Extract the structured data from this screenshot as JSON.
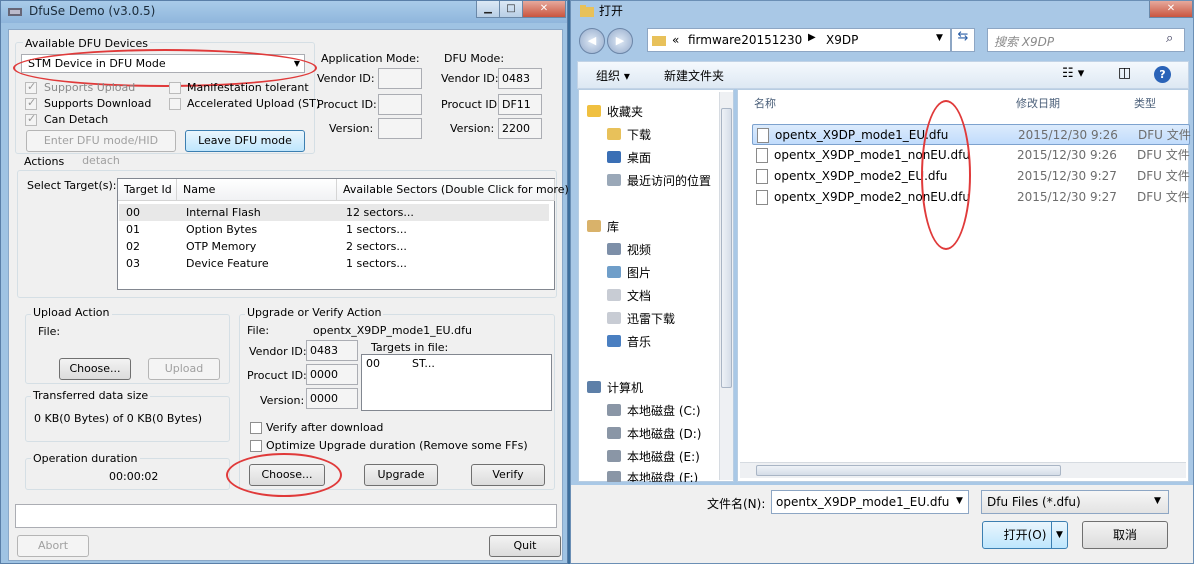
{
  "left": {
    "title": "DfuSe Demo (v3.0.5)",
    "available_label": "Available DFU Devices",
    "device_select": "STM Device in DFU Mode",
    "supports_upload": "Supports Upload",
    "supports_download": "Supports Download",
    "can_detach": "Can Detach",
    "manifestation": "Manifestation tolerant",
    "accel_upload": "Accelerated Upload (ST)",
    "enter_dfu_btn": "Enter DFU mode/HID detach",
    "leave_dfu_btn": "Leave DFU mode",
    "app_mode_label": "Application Mode:",
    "dfu_mode_label": "DFU Mode:",
    "vendor_id_label": "Vendor ID:",
    "procuct_id_label": "Procuct ID:",
    "version_label": "Version:",
    "dfu_vendor": "0483",
    "dfu_product": "DF11",
    "dfu_version": "2200",
    "actions_label": "Actions",
    "select_target_label": "Select Target(s):",
    "table_headers": [
      "Target Id",
      "Name",
      "Available Sectors (Double Click for more)"
    ],
    "table_rows": [
      {
        "id": "00",
        "name": "Internal Flash",
        "sectors": "12 sectors..."
      },
      {
        "id": "01",
        "name": "Option Bytes",
        "sectors": "1 sectors..."
      },
      {
        "id": "02",
        "name": "OTP Memory",
        "sectors": "2 sectors..."
      },
      {
        "id": "03",
        "name": "Device Feature",
        "sectors": "1 sectors..."
      }
    ],
    "upload_action_label": "Upload Action",
    "file_label": "File:",
    "choose_btn": "Choose...",
    "upload_btn": "Upload",
    "transferred_label": "Transferred data size",
    "transferred_value": "0 KB(0 Bytes) of 0 KB(0 Bytes)",
    "duration_label": "Operation duration",
    "duration_value": "00:00:02",
    "upgrade_label": "Upgrade or Verify Action",
    "upgrade_file": "opentx_X9DP_mode1_EU.dfu",
    "up_vendor": "0483",
    "up_product": "0000",
    "up_version": "0000",
    "targets_in_file_label": "Targets in file:",
    "targets_id": "00",
    "targets_name": "ST...",
    "verify_after": "Verify after download",
    "optimize": "Optimize Upgrade duration (Remove some FFs)",
    "choose2_btn": "Choose...",
    "upgrade_btn": "Upgrade",
    "verify_btn": "Verify",
    "abort_btn": "Abort",
    "quit_btn": "Quit"
  },
  "right": {
    "title": "打开",
    "breadcrumb_prefix": "«",
    "breadcrumb_1": "firmware20151230",
    "breadcrumb_2": "X9DP",
    "search_placeholder": "搜索 X9DP",
    "organize": "组织",
    "new_folder": "新建文件夹",
    "nav_items": [
      "收藏夹",
      "下载",
      "桌面",
      "最近访问的位置",
      "库",
      "视频",
      "图片",
      "文档",
      "迅雷下载",
      "音乐",
      "计算机",
      "本地磁盘 (C:)",
      "本地磁盘 (D:)",
      "本地磁盘 (E:)",
      "本地磁盘 (F:)"
    ],
    "col_name": "名称",
    "col_date": "修改日期",
    "col_type": "类型",
    "files": [
      {
        "name": "opentx_X9DP_mode1_EU.dfu",
        "date": "2015/12/30 9:26",
        "type": "DFU 文件"
      },
      {
        "name": "opentx_X9DP_mode1_nonEU.dfu",
        "date": "2015/12/30 9:26",
        "type": "DFU 文件"
      },
      {
        "name": "opentx_X9DP_mode2_EU.dfu",
        "date": "2015/12/30 9:27",
        "type": "DFU 文件"
      },
      {
        "name": "opentx_X9DP_mode2_nonEU.dfu",
        "date": "2015/12/30 9:27",
        "type": "DFU 文件"
      }
    ],
    "filename_label": "文件名(N):",
    "filename_value": "opentx_X9DP_mode1_EU.dfu",
    "filter_value": "Dfu Files (*.dfu)",
    "open_btn": "打开(O)",
    "cancel_btn": "取消"
  },
  "colors": {
    "annotation": "#e03a3a",
    "selection": "#c1dcfc",
    "titlebar": "#a9cbe9"
  }
}
